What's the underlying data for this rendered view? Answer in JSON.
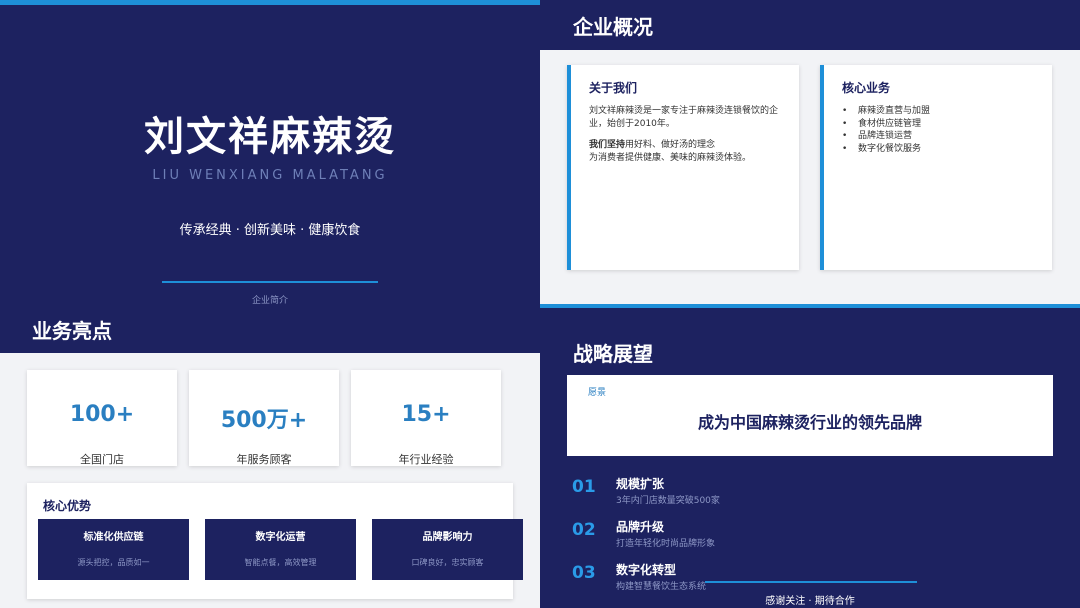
{
  "cover": {
    "title": "刘文祥麻辣烫",
    "subtitle_en": "LIU WENXIANG MALATANG",
    "slogan": "传承经典 · 创新美味 · 健康饮食",
    "caption": "企业简介"
  },
  "overview": {
    "section_title": "企业概况",
    "about": {
      "heading": "关于我们",
      "para1": "刘文祥麻辣烫是一家专注于麻辣烫连锁餐饮的企业，始创于2010年。",
      "para2_bold": "我们坚持",
      "para2_rest": "用好料、做好汤的理念",
      "para2_line2": "为消费者提供健康、美味的麻辣烫体验。"
    },
    "business": {
      "heading": "核心业务",
      "items": [
        "麻辣烫直营与加盟",
        "食材供应链管理",
        "品牌连锁运营",
        "数字化餐饮服务"
      ]
    }
  },
  "highlights": {
    "section_title": "业务亮点",
    "stats": [
      {
        "value": "100+",
        "label": "全国门店"
      },
      {
        "value": "500万+",
        "label": "年服务顾客"
      },
      {
        "value": "15+",
        "label": "年行业经验"
      }
    ],
    "advantages": {
      "heading": "核心优势",
      "tiles": [
        {
          "title": "标准化供应链",
          "desc": "源头把控，品质如一"
        },
        {
          "title": "数字化运营",
          "desc": "智能点餐，高效管理"
        },
        {
          "title": "品牌影响力",
          "desc": "口碑良好，忠实顾客"
        }
      ]
    }
  },
  "strategy": {
    "section_title": "战略展望",
    "vision_tag": "愿景",
    "vision_text": "成为中国麻辣烫行业的领先品牌",
    "steps": [
      {
        "no": "01",
        "title": "规模扩张",
        "desc": "3年内门店数量突破500家"
      },
      {
        "no": "02",
        "title": "品牌升级",
        "desc": "打造年轻化时尚品牌形象"
      },
      {
        "no": "03",
        "title": "数字化转型",
        "desc": "构建智慧餐饮生态系统"
      }
    ],
    "thanks": "感谢关注 · 期待合作"
  },
  "colors": {
    "navy": "#1d2260",
    "accent_blue": "#1e8fd8",
    "stat_blue": "#2a7fc1"
  }
}
